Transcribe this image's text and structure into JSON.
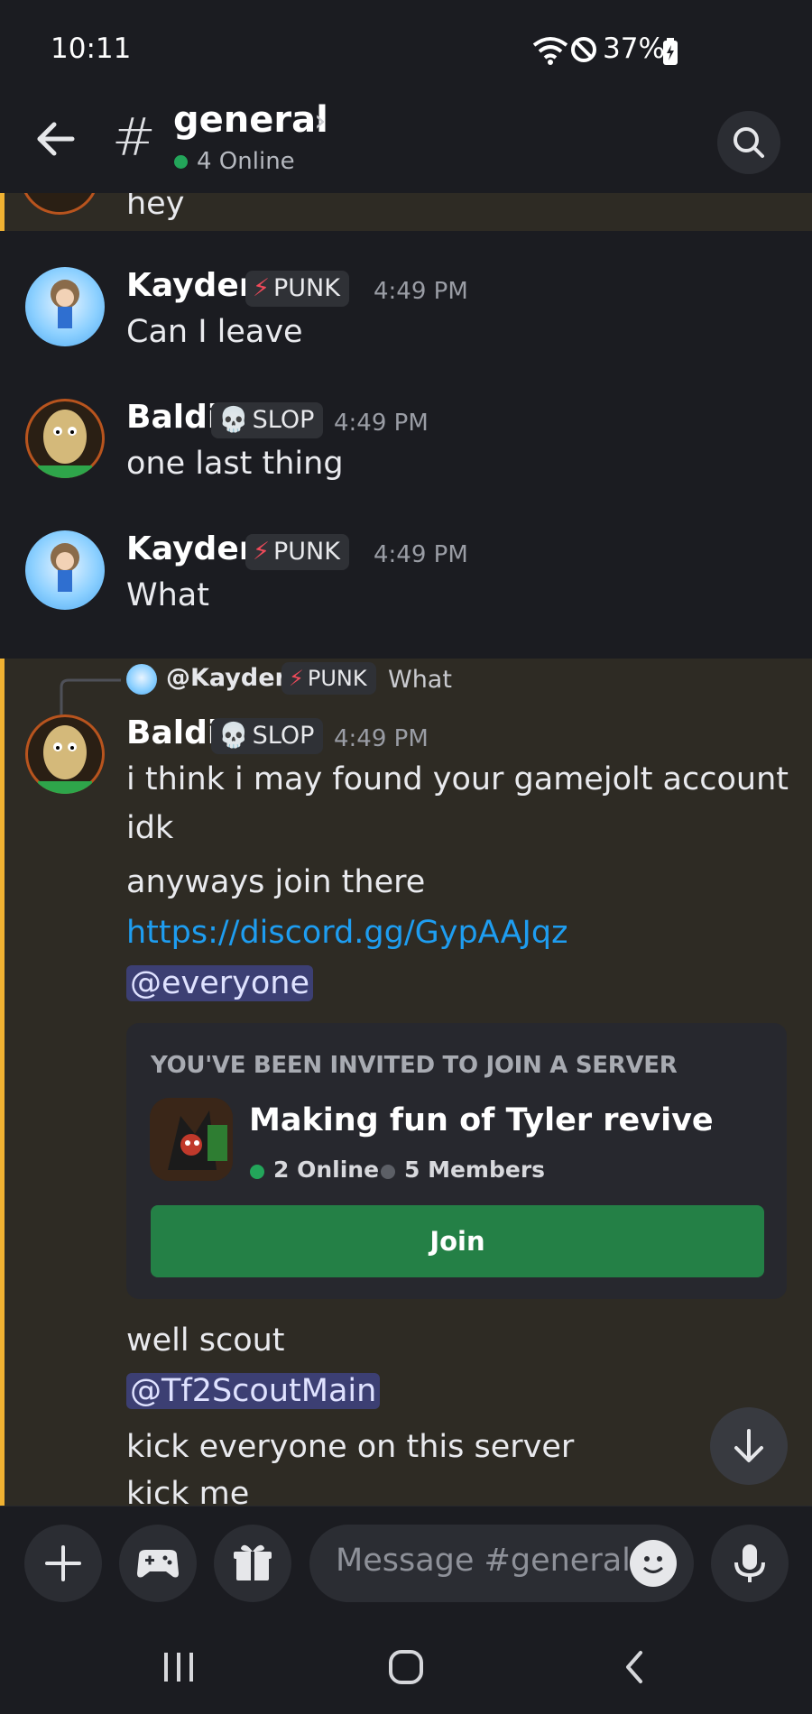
{
  "status_bar": {
    "time": "10:11",
    "battery": "37%"
  },
  "header": {
    "hash": "#",
    "channel": "general",
    "online": "4 Online"
  },
  "messages": {
    "top_partial": "hey",
    "m1": {
      "user": "Kayden",
      "tag": "PUNK",
      "time": "4:49 PM",
      "text": "Can I leave"
    },
    "m2": {
      "user": "Baldi",
      "tag": "SLOP",
      "time": "4:49 PM",
      "text": "one last thing"
    },
    "m3": {
      "user": "Kayden",
      "tag": "PUNK",
      "time": "4:49 PM",
      "text": "What"
    },
    "reply": {
      "user": "@Kayden",
      "tag": "PUNK",
      "text": "What"
    },
    "m4": {
      "user": "Baldi",
      "tag": "SLOP",
      "time": "4:49 PM",
      "line1": "i think i may found your gamejolt account",
      "line2": "idk",
      "line3": "anyways join there",
      "link": "https://discord.gg/GypAAJqz",
      "mention": "@everyone"
    },
    "m5": {
      "line1": "well scout",
      "mention": "@Tf2ScoutMain",
      "line2": "kick everyone on this server",
      "line3": "kick me"
    }
  },
  "invite": {
    "heading": "YOU'VE BEEN INVITED TO JOIN A SERVER",
    "server_name": "Making fun of Tyler revive",
    "online": "2 Online",
    "members": "5 Members",
    "join_label": "Join"
  },
  "composer": {
    "placeholder": "Message #general"
  },
  "colors": {
    "accent_green": "#248046",
    "online_green": "#23a55a",
    "link_blue": "#1e9df0",
    "highlight_bar": "#f0b232"
  },
  "icons": [
    "back-arrow-icon",
    "search-icon",
    "plus-icon",
    "gamepad-icon",
    "gift-icon",
    "emoji-icon",
    "microphone-icon",
    "arrow-down-icon",
    "recents-icon",
    "home-icon",
    "nav-back-icon",
    "wifi-icon",
    "dnd-icon",
    "battery-icon"
  ]
}
